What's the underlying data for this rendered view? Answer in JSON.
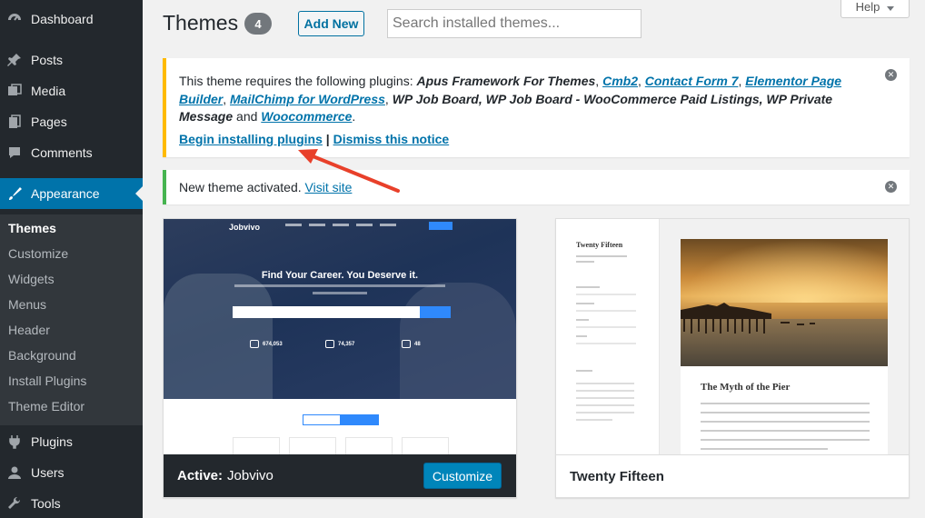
{
  "sidebar": {
    "items": [
      {
        "label": "Dashboard",
        "icon": "dashboard-icon"
      },
      {
        "label": "Posts",
        "icon": "pin-icon"
      },
      {
        "label": "Media",
        "icon": "media-icon"
      },
      {
        "label": "Pages",
        "icon": "pages-icon"
      },
      {
        "label": "Comments",
        "icon": "comments-icon"
      },
      {
        "label": "Appearance",
        "icon": "brush-icon"
      },
      {
        "label": "Plugins",
        "icon": "plug-icon"
      },
      {
        "label": "Users",
        "icon": "user-icon"
      },
      {
        "label": "Tools",
        "icon": "wrench-icon"
      }
    ],
    "submenu": [
      "Themes",
      "Customize",
      "Widgets",
      "Menus",
      "Header",
      "Background",
      "Install Plugins",
      "Theme Editor"
    ],
    "current": "Appearance",
    "current_sub": "Themes"
  },
  "header": {
    "title": "Themes",
    "count": "4",
    "add_new": "Add New",
    "search_placeholder": "Search installed themes...",
    "help": "Help"
  },
  "notice_plugins": {
    "prefix": "This theme requires the following plugins: ",
    "p1": "Apus Framework For Themes",
    "sep1": ", ",
    "p2": "Cmb2",
    "sep2": ", ",
    "p3": "Contact Form 7",
    "sep3": ", ",
    "p4": "Elementor Page Builder",
    "sep4": ", ",
    "p5": "MailChimp for WordPress",
    "sep5": ", ",
    "p6": "WP Job Board, WP Job Board - WooCommerce Paid Listings, WP Private Message",
    "and": " and ",
    "p7": "Woocommerce",
    "end": ".",
    "begin": "Begin installing plugins",
    "pipe": " | ",
    "dismiss": "Dismiss this notice"
  },
  "notice_activated": {
    "text": "New theme activated. ",
    "link": "Visit site"
  },
  "themes": {
    "active": {
      "prefix": "Active:",
      "name": "Jobvivo",
      "button": "Customize",
      "preview": {
        "logo": "Jobvivo",
        "headline": "Find Your Career. You Deserve it.",
        "stats": [
          "674,053",
          "74,357",
          "48"
        ]
      }
    },
    "other": {
      "name": "Twenty Fifteen",
      "preview": {
        "site_title": "Twenty Fifteen",
        "post_title": "The Myth of the Pier"
      }
    }
  },
  "colors": {
    "accent": "#0073aa",
    "warning": "#ffba00",
    "success": "#46b450",
    "arrow": "#e8402a"
  }
}
